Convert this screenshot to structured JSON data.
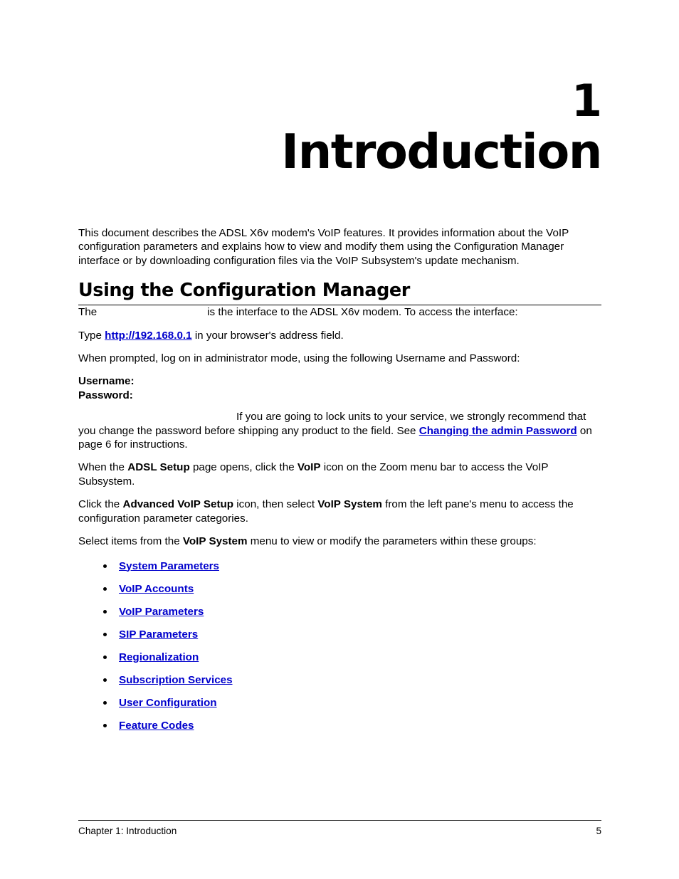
{
  "chapter": {
    "number": "1",
    "title": "Introduction"
  },
  "intro_paragraph": "This document describes the ADSL X6v modem's VoIP features. It provides information about the VoIP configuration parameters and explains how to view and modify them using the Configuration Manager interface or by downloading configuration files via the VoIP Subsystem's update mechanism.",
  "section": {
    "heading": "Using the Configuration Manager",
    "lead": {
      "prefix": "The",
      "suffix": "is the interface to the ADSL X6v modem. To access the interface:"
    },
    "step_type": {
      "prefix": "Type",
      "link": "http://192.168.0.1",
      "suffix": "in your browser's address field."
    },
    "step_prompt": "When prompted, log on in administrator mode, using the following Username and Password:",
    "credentials": {
      "username_label": "Username:",
      "username_value": "",
      "password_label": "Password:",
      "password_value": ""
    },
    "note": {
      "text_1": "If you are going to lock units to your service, we strongly recommend that you change the password before shipping any product to the field. See",
      "link": "Changing the admin Password",
      "text_2": "on page 6 for instructions."
    },
    "step_adsl": {
      "part_1": "When the",
      "bold_1": "ADSL Setup",
      "part_2": "page opens, click the",
      "bold_2": "VoIP",
      "part_3": "icon on the Zoom menu bar to access the VoIP Subsystem."
    },
    "step_advanced": {
      "part_1": "Click the",
      "bold_1": "Advanced VoIP Setup",
      "part_2": "icon, then select",
      "bold_2": "VoIP System",
      "part_3": "from the left pane's menu to access the configuration parameter categories."
    },
    "step_select": {
      "part_1": "Select items from the",
      "bold_1": "VoIP System",
      "part_2": "menu to view or modify the parameters within these groups:"
    }
  },
  "link_list": [
    {
      "label": "System Parameters"
    },
    {
      "label": "VoIP Accounts"
    },
    {
      "label": "VoIP Parameters"
    },
    {
      "label": "SIP Parameters"
    },
    {
      "label": "Regionalization"
    },
    {
      "label": "Subscription Services"
    },
    {
      "label": "User Configuration"
    },
    {
      "label": "Feature Codes"
    }
  ],
  "footer": {
    "left": "Chapter 1: Introduction",
    "page_number": "5"
  },
  "colors": {
    "link": "#0000CC",
    "text": "#000000",
    "background": "#FFFFFF"
  }
}
